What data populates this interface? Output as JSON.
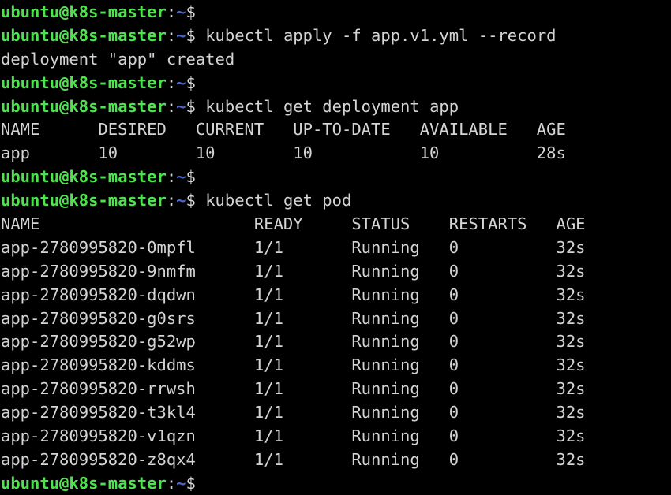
{
  "terminal": {
    "title": "ubuntu@k8s-master terminal",
    "colors": {
      "background": "#000000",
      "foreground": "#d4d4d4",
      "prompt_user": "#4ee24e",
      "prompt_path": "#4a68d0",
      "prompt_punct": "#d8d8d8"
    },
    "prompt": {
      "user_host": "ubuntu@k8s-master",
      "colon": ":",
      "path": "~",
      "dollar": "$"
    },
    "lines": [
      {
        "type": "prompt",
        "command": ""
      },
      {
        "type": "prompt",
        "command": "kubectl apply -f app.v1.yml --record"
      },
      {
        "type": "output",
        "text": "deployment \"app\" created"
      },
      {
        "type": "prompt",
        "command": ""
      },
      {
        "type": "prompt",
        "command": "kubectl get deployment app"
      },
      {
        "type": "output",
        "text": "NAME      DESIRED   CURRENT   UP-TO-DATE   AVAILABLE   AGE"
      },
      {
        "type": "output",
        "text": "app       10        10        10           10          28s"
      },
      {
        "type": "prompt",
        "command": ""
      },
      {
        "type": "prompt",
        "command": "kubectl get pod"
      },
      {
        "type": "output",
        "text": "NAME                      READY     STATUS    RESTARTS   AGE"
      },
      {
        "type": "output",
        "text": "app-2780995820-0mpfl      1/1       Running   0          32s"
      },
      {
        "type": "output",
        "text": "app-2780995820-9nmfm      1/1       Running   0          32s"
      },
      {
        "type": "output",
        "text": "app-2780995820-dqdwn      1/1       Running   0          32s"
      },
      {
        "type": "output",
        "text": "app-2780995820-g0srs      1/1       Running   0          32s"
      },
      {
        "type": "output",
        "text": "app-2780995820-g52wp      1/1       Running   0          32s"
      },
      {
        "type": "output",
        "text": "app-2780995820-kddms      1/1       Running   0          32s"
      },
      {
        "type": "output",
        "text": "app-2780995820-rrwsh      1/1       Running   0          32s"
      },
      {
        "type": "output",
        "text": "app-2780995820-t3kl4      1/1       Running   0          32s"
      },
      {
        "type": "output",
        "text": "app-2780995820-v1qzn      1/1       Running   0          32s"
      },
      {
        "type": "output",
        "text": "app-2780995820-z8qx4      1/1       Running   0          32s"
      },
      {
        "type": "prompt",
        "command": ""
      }
    ],
    "commands": [
      "kubectl apply -f app.v1.yml --record",
      "kubectl get deployment app",
      "kubectl get pod"
    ],
    "deployment_table": {
      "headers": [
        "NAME",
        "DESIRED",
        "CURRENT",
        "UP-TO-DATE",
        "AVAILABLE",
        "AGE"
      ],
      "rows": [
        [
          "app",
          "10",
          "10",
          "10",
          "10",
          "28s"
        ]
      ]
    },
    "pod_table": {
      "headers": [
        "NAME",
        "READY",
        "STATUS",
        "RESTARTS",
        "AGE"
      ],
      "rows": [
        [
          "app-2780995820-0mpfl",
          "1/1",
          "Running",
          "0",
          "32s"
        ],
        [
          "app-2780995820-9nmfm",
          "1/1",
          "Running",
          "0",
          "32s"
        ],
        [
          "app-2780995820-dqdwn",
          "1/1",
          "Running",
          "0",
          "32s"
        ],
        [
          "app-2780995820-g0srs",
          "1/1",
          "Running",
          "0",
          "32s"
        ],
        [
          "app-2780995820-g52wp",
          "1/1",
          "Running",
          "0",
          "32s"
        ],
        [
          "app-2780995820-kddms",
          "1/1",
          "Running",
          "0",
          "32s"
        ],
        [
          "app-2780995820-rrwsh",
          "1/1",
          "Running",
          "0",
          "32s"
        ],
        [
          "app-2780995820-t3kl4",
          "1/1",
          "Running",
          "0",
          "32s"
        ],
        [
          "app-2780995820-v1qzn",
          "1/1",
          "Running",
          "0",
          "32s"
        ],
        [
          "app-2780995820-z8qx4",
          "1/1",
          "Running",
          "0",
          "32s"
        ]
      ]
    },
    "messages": [
      "deployment \"app\" created"
    ]
  }
}
